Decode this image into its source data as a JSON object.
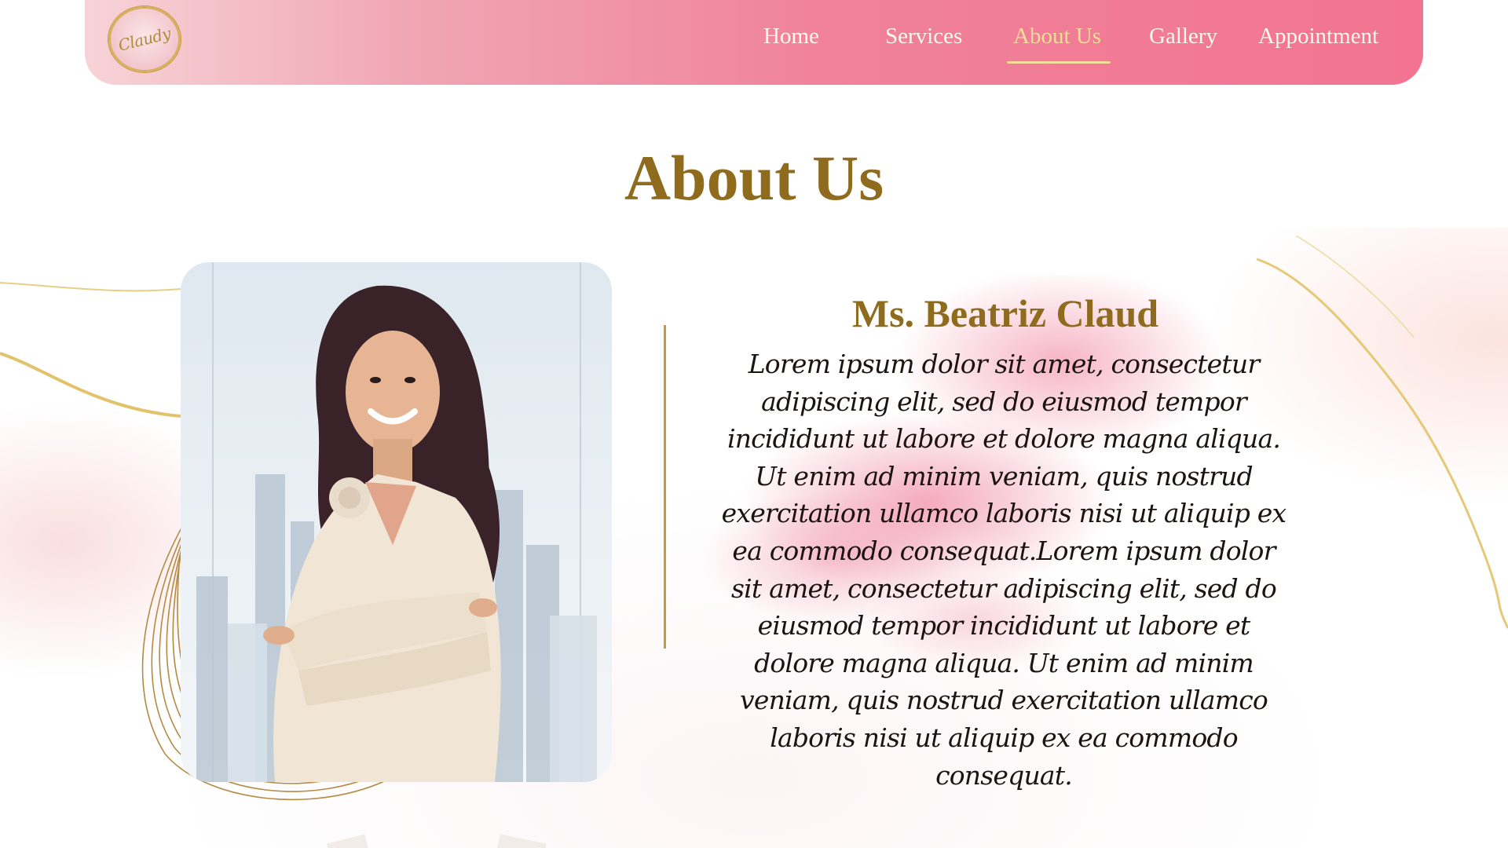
{
  "navbar": {
    "logo_text": "Claudy",
    "items": [
      {
        "label": "Home",
        "active": false
      },
      {
        "label": "Services",
        "active": false
      },
      {
        "label": "About Us",
        "active": true
      },
      {
        "label": "Gallery",
        "active": false
      },
      {
        "label": "Appointment",
        "active": false
      }
    ]
  },
  "page": {
    "title": "About Us"
  },
  "profile": {
    "name": "Ms. Beatriz Claud",
    "bio": "Lorem ipsum dolor sit amet, consectetur adipiscing elit, sed do eiusmod tempor incididunt ut labore et dolore magna aliqua. Ut enim ad minim veniam, quis nostrud exercitation ullamco laboris nisi ut aliquip ex ea commodo consequat.Lorem ipsum dolor sit amet, consectetur adipiscing elit, sed do eiusmod tempor incididunt ut labore et dolore magna aliqua. Ut enim ad minim veniam, quis nostrud exercitation ullamco laboris nisi ut aliquip ex ea commodo consequat.",
    "photo_icon": "portrait-photo"
  },
  "colors": {
    "brand_pink": "#f27491",
    "gold": "#8e6b1d",
    "nav_active": "#f5dc9b",
    "divider": "#c69b3f"
  }
}
